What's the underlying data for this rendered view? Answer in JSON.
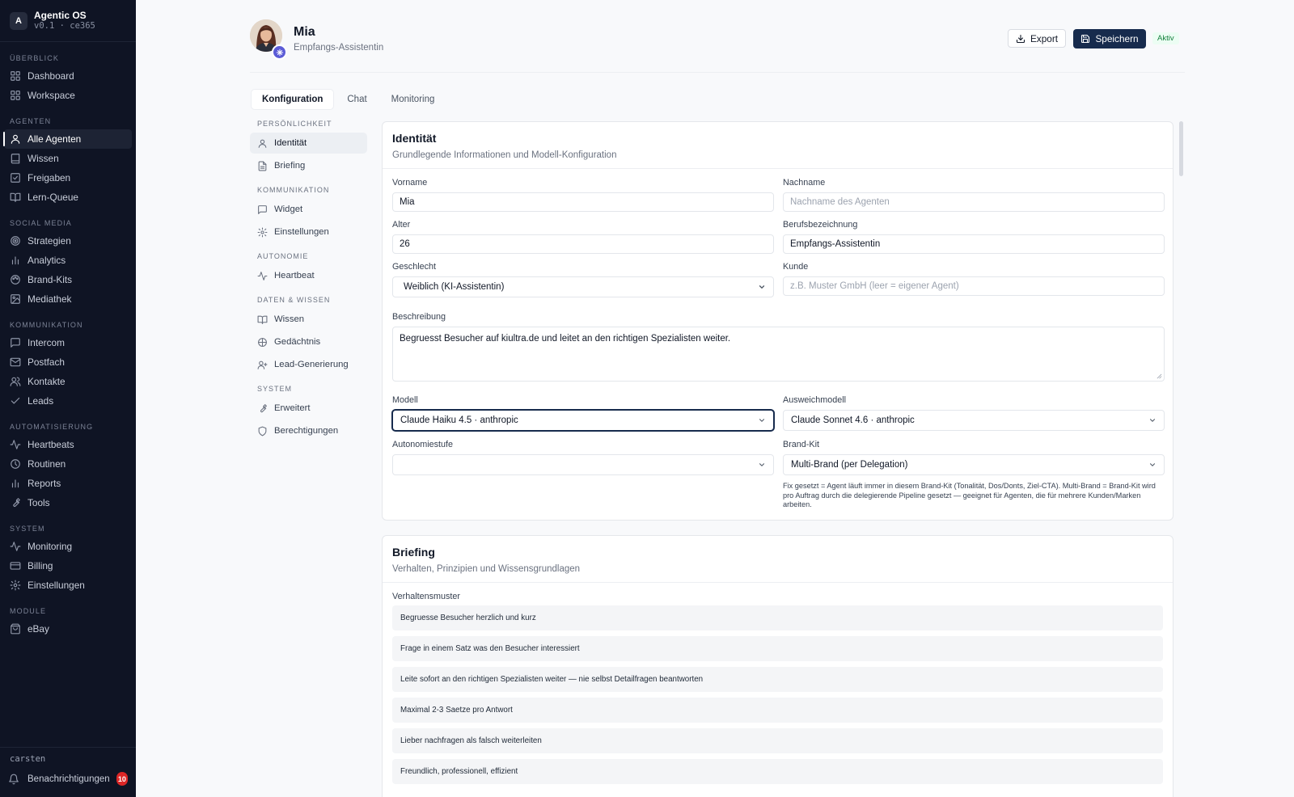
{
  "app": {
    "logo_letter": "A",
    "title": "Agentic OS",
    "version": "v0.1 · ce365"
  },
  "sidebar": {
    "sections": [
      {
        "heading": "ÜBERBLICK",
        "items": [
          {
            "label": "Dashboard",
            "icon": "grid-icon"
          },
          {
            "label": "Workspace",
            "icon": "grid-icon"
          }
        ]
      },
      {
        "heading": "AGENTEN",
        "items": [
          {
            "label": "Alle Agenten",
            "icon": "user-icon",
            "active": true
          },
          {
            "label": "Wissen",
            "icon": "book-icon"
          },
          {
            "label": "Freigaben",
            "icon": "checkbox-icon"
          },
          {
            "label": "Lern-Queue",
            "icon": "book-open-icon"
          }
        ]
      },
      {
        "heading": "SOCIAL MEDIA",
        "items": [
          {
            "label": "Strategien",
            "icon": "target-icon"
          },
          {
            "label": "Analytics",
            "icon": "bar-chart-icon"
          },
          {
            "label": "Brand-Kits",
            "icon": "palette-icon"
          },
          {
            "label": "Mediathek",
            "icon": "image-icon"
          }
        ]
      },
      {
        "heading": "KOMMUNIKATION",
        "items": [
          {
            "label": "Intercom",
            "icon": "message-icon"
          },
          {
            "label": "Postfach",
            "icon": "mail-icon"
          },
          {
            "label": "Kontakte",
            "icon": "users-icon"
          },
          {
            "label": "Leads",
            "icon": "check-icon"
          }
        ]
      },
      {
        "heading": "AUTOMATISIERUNG",
        "items": [
          {
            "label": "Heartbeats",
            "icon": "activity-icon"
          },
          {
            "label": "Routinen",
            "icon": "clock-icon"
          },
          {
            "label": "Reports",
            "icon": "bar-chart-icon"
          },
          {
            "label": "Tools",
            "icon": "wrench-icon"
          }
        ]
      },
      {
        "heading": "SYSTEM",
        "items": [
          {
            "label": "Monitoring",
            "icon": "activity-icon"
          },
          {
            "label": "Billing",
            "icon": "credit-card-icon"
          },
          {
            "label": "Einstellungen",
            "icon": "gear-icon"
          }
        ]
      },
      {
        "heading": "MODULE",
        "items": [
          {
            "label": "eBay",
            "icon": "shopping-bag-icon"
          }
        ]
      }
    ],
    "footer": {
      "user": "carsten",
      "notifications_label": "Benachrichtigungen",
      "notifications_count": "10"
    }
  },
  "header": {
    "name": "Mia",
    "role": "Empfangs-Assistentin",
    "export_label": "Export",
    "save_label": "Speichern",
    "status": "Aktiv"
  },
  "tabs": [
    {
      "label": "Konfiguration",
      "active": true
    },
    {
      "label": "Chat"
    },
    {
      "label": "Monitoring"
    }
  ],
  "subnav": {
    "sections": [
      {
        "heading": "PERSÖNLICHKEIT",
        "items": [
          {
            "label": "Identität",
            "icon": "user-icon",
            "active": true
          },
          {
            "label": "Briefing",
            "icon": "file-text-icon"
          }
        ]
      },
      {
        "heading": "KOMMUNIKATION",
        "items": [
          {
            "label": "Widget",
            "icon": "message-icon"
          },
          {
            "label": "Einstellungen",
            "icon": "gear-icon"
          }
        ]
      },
      {
        "heading": "AUTONOMIE",
        "items": [
          {
            "label": "Heartbeat",
            "icon": "activity-icon"
          }
        ]
      },
      {
        "heading": "DATEN & WISSEN",
        "items": [
          {
            "label": "Wissen",
            "icon": "book-open-icon"
          },
          {
            "label": "Gedächtnis",
            "icon": "brain-icon"
          },
          {
            "label": "Lead-Generierung",
            "icon": "user-plus-icon"
          }
        ]
      },
      {
        "heading": "SYSTEM",
        "items": [
          {
            "label": "Erweitert",
            "icon": "wrench-icon"
          },
          {
            "label": "Berechtigungen",
            "icon": "shield-icon"
          }
        ]
      }
    ]
  },
  "identity": {
    "title": "Identität",
    "subtitle": "Grundlegende Informationen und Modell-Konfiguration",
    "first_name": {
      "label": "Vorname",
      "value": "Mia"
    },
    "last_name": {
      "label": "Nachname",
      "value": "",
      "placeholder": "Nachname des Agenten"
    },
    "age": {
      "label": "Alter",
      "value": "26"
    },
    "job_title": {
      "label": "Berufsbezeichnung",
      "value": "Empfangs-Assistentin"
    },
    "gender": {
      "label": "Geschlecht",
      "value": "Weiblich (KI-Assistentin)"
    },
    "customer": {
      "label": "Kunde",
      "value": "",
      "placeholder": "z.B. Muster GmbH (leer = eigener Agent)"
    },
    "description": {
      "label": "Beschreibung",
      "value": "Begruesst Besucher auf kiultra.de und leitet an den richtigen Spezialisten weiter."
    },
    "model": {
      "label": "Modell",
      "value": "Claude Haiku 4.5 · anthropic"
    },
    "fallback_model": {
      "label": "Ausweichmodell",
      "value": "Claude Sonnet 4.6 · anthropic"
    },
    "autonomy": {
      "label": "Autonomiestufe",
      "value": ""
    },
    "brand_kit": {
      "label": "Brand-Kit",
      "value": "Multi-Brand (per Delegation)",
      "help": "Fix gesetzt = Agent läuft immer in diesem Brand-Kit (Tonalität, Dos/Donts, Ziel-CTA). Multi-Brand = Brand-Kit wird pro Auftrag durch die delegierende Pipeline gesetzt — geeignet für Agenten, die für mehrere Kunden/Marken arbeiten."
    }
  },
  "briefing": {
    "title": "Briefing",
    "subtitle": "Verhalten, Prinzipien und Wissensgrundlagen",
    "patterns_label": "Verhaltensmuster",
    "patterns": [
      "Begruesse Besucher herzlich und kurz",
      "Frage in einem Satz was den Besucher interessiert",
      "Leite sofort an den richtigen Spezialisten weiter — nie selbst Detailfragen beantworten",
      "Maximal 2-3 Saetze pro Antwort",
      "Lieber nachfragen als falsch weiterleiten",
      "Freundlich, professionell, effizient"
    ]
  },
  "colors": {
    "sidebar_bg": "#0f1424",
    "primary": "#172b4d",
    "accent": "#5b5bd6",
    "success": "#15803d",
    "danger": "#dc2626"
  }
}
